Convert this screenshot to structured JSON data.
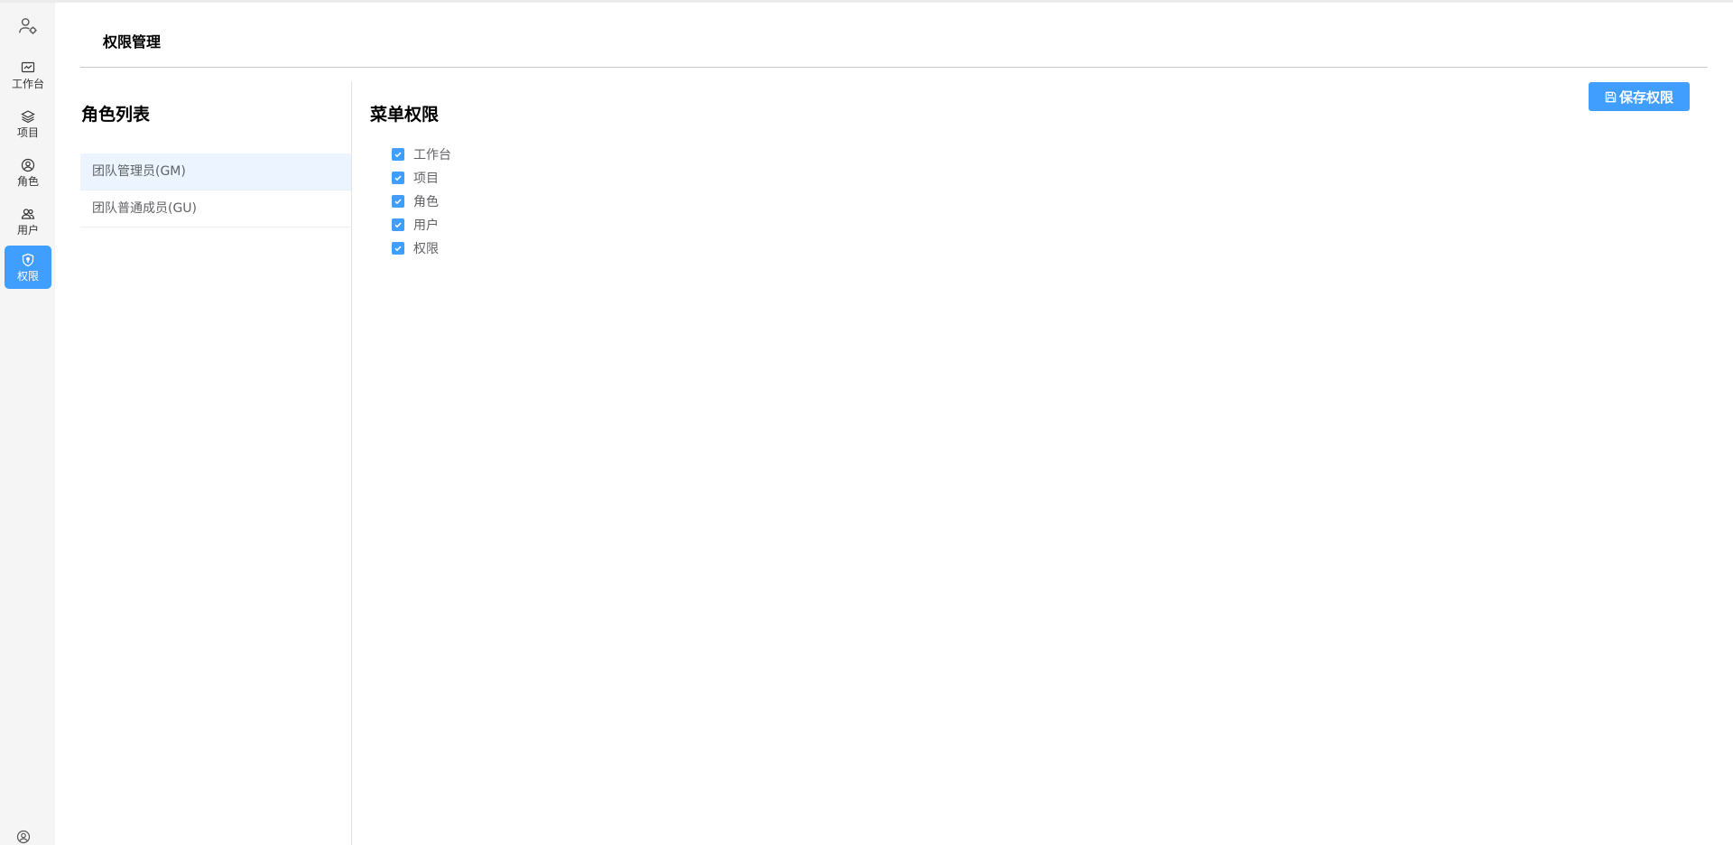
{
  "page": {
    "title": "权限管理"
  },
  "sidebar": {
    "items": [
      {
        "label": "工作台",
        "icon": "chart-icon",
        "active": false
      },
      {
        "label": "项目",
        "icon": "layers-icon",
        "active": false
      },
      {
        "label": "角色",
        "icon": "user-circle-icon",
        "active": false
      },
      {
        "label": "用户",
        "icon": "users-icon",
        "active": false
      },
      {
        "label": "权限",
        "icon": "shield-icon",
        "active": true
      }
    ]
  },
  "roles": {
    "title": "角色列表",
    "items": [
      {
        "label": "团队管理员(GM)",
        "selected": true
      },
      {
        "label": "团队普通成员(GU)",
        "selected": false
      }
    ]
  },
  "menu_permissions": {
    "title": "菜单权限",
    "items": [
      {
        "label": "工作台",
        "checked": true
      },
      {
        "label": "项目",
        "checked": true
      },
      {
        "label": "角色",
        "checked": true
      },
      {
        "label": "用户",
        "checked": true
      },
      {
        "label": "权限",
        "checked": true
      }
    ]
  },
  "toolbar": {
    "save_label": "保存权限"
  },
  "colors": {
    "accent": "#409eff",
    "selected_row": "#ecf5ff"
  }
}
